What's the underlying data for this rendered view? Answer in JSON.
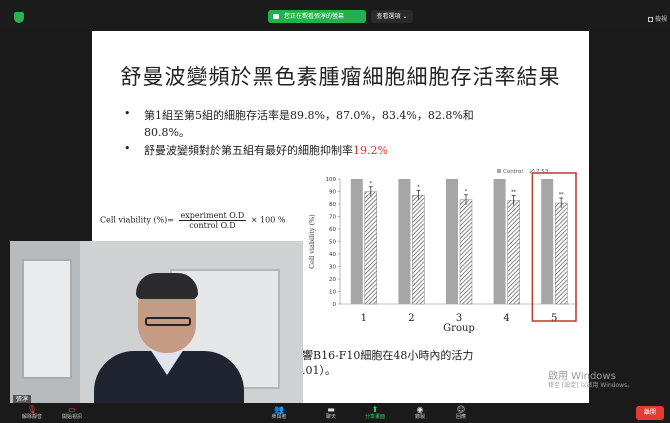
{
  "topbar": {
    "share_banner": "您正在觀看張淳的螢幕",
    "view_options": "查看選項 ⌄",
    "view_label": "檢視"
  },
  "slide": {
    "title": "舒曼波變頻於黑色素腫瘤細胞細胞存活率結果",
    "bullet_marker": "•",
    "bullet1_line1": "第1組至第5組的細胞存活率是89.8%，87.0%，83.4%，82.8%和",
    "bullet1_line2": "80.8%。",
    "bullet2_text": "舒曼波變頻對於第五組有最好的細胞抑制率",
    "bullet2_value": "19.2%",
    "formula_lhs": "Cell viability (%)=",
    "formula_num": "experiment O.D",
    "formula_den": "control O.D",
    "formula_rhs": "× 100 %",
    "caption_line1": "響B16-F10細胞在48小時內的活力",
    "caption_line2": ".01）。"
  },
  "watermark": {
    "line1": "啟用 Windows",
    "line2": "移至 [設定] 以啟用 Windows。"
  },
  "video": {
    "name": "張淳"
  },
  "toolbar": {
    "unmute": "解除靜音",
    "start_video": "開始視訊",
    "participants": "參與者",
    "chat": "聊天",
    "share_screen": "分享畫面",
    "record": "錄製",
    "reactions": "回應",
    "end": "離開"
  },
  "chart_data": {
    "type": "bar",
    "xlabel": "Group",
    "ylabel": "Cell viability (%)",
    "ylim": [
      0,
      100
    ],
    "yticks": [
      0,
      10,
      20,
      30,
      40,
      50,
      60,
      70,
      80,
      90,
      100
    ],
    "categories": [
      "1",
      "2",
      "3",
      "4",
      "5"
    ],
    "series": [
      {
        "name": "Control",
        "values": [
          100,
          100,
          100,
          100,
          100
        ],
        "color": "#a6a6a6"
      },
      {
        "name": "7.53",
        "values": [
          89.8,
          87.0,
          83.4,
          82.8,
          80.8
        ],
        "color": "#555555"
      }
    ],
    "significance": [
      "*",
      "*",
      "*",
      "**",
      "**"
    ],
    "legend_labels": [
      "Control",
      "7.53"
    ],
    "legend": "top-right",
    "highlight_category": "5",
    "highlight_color": "#c0392b"
  }
}
